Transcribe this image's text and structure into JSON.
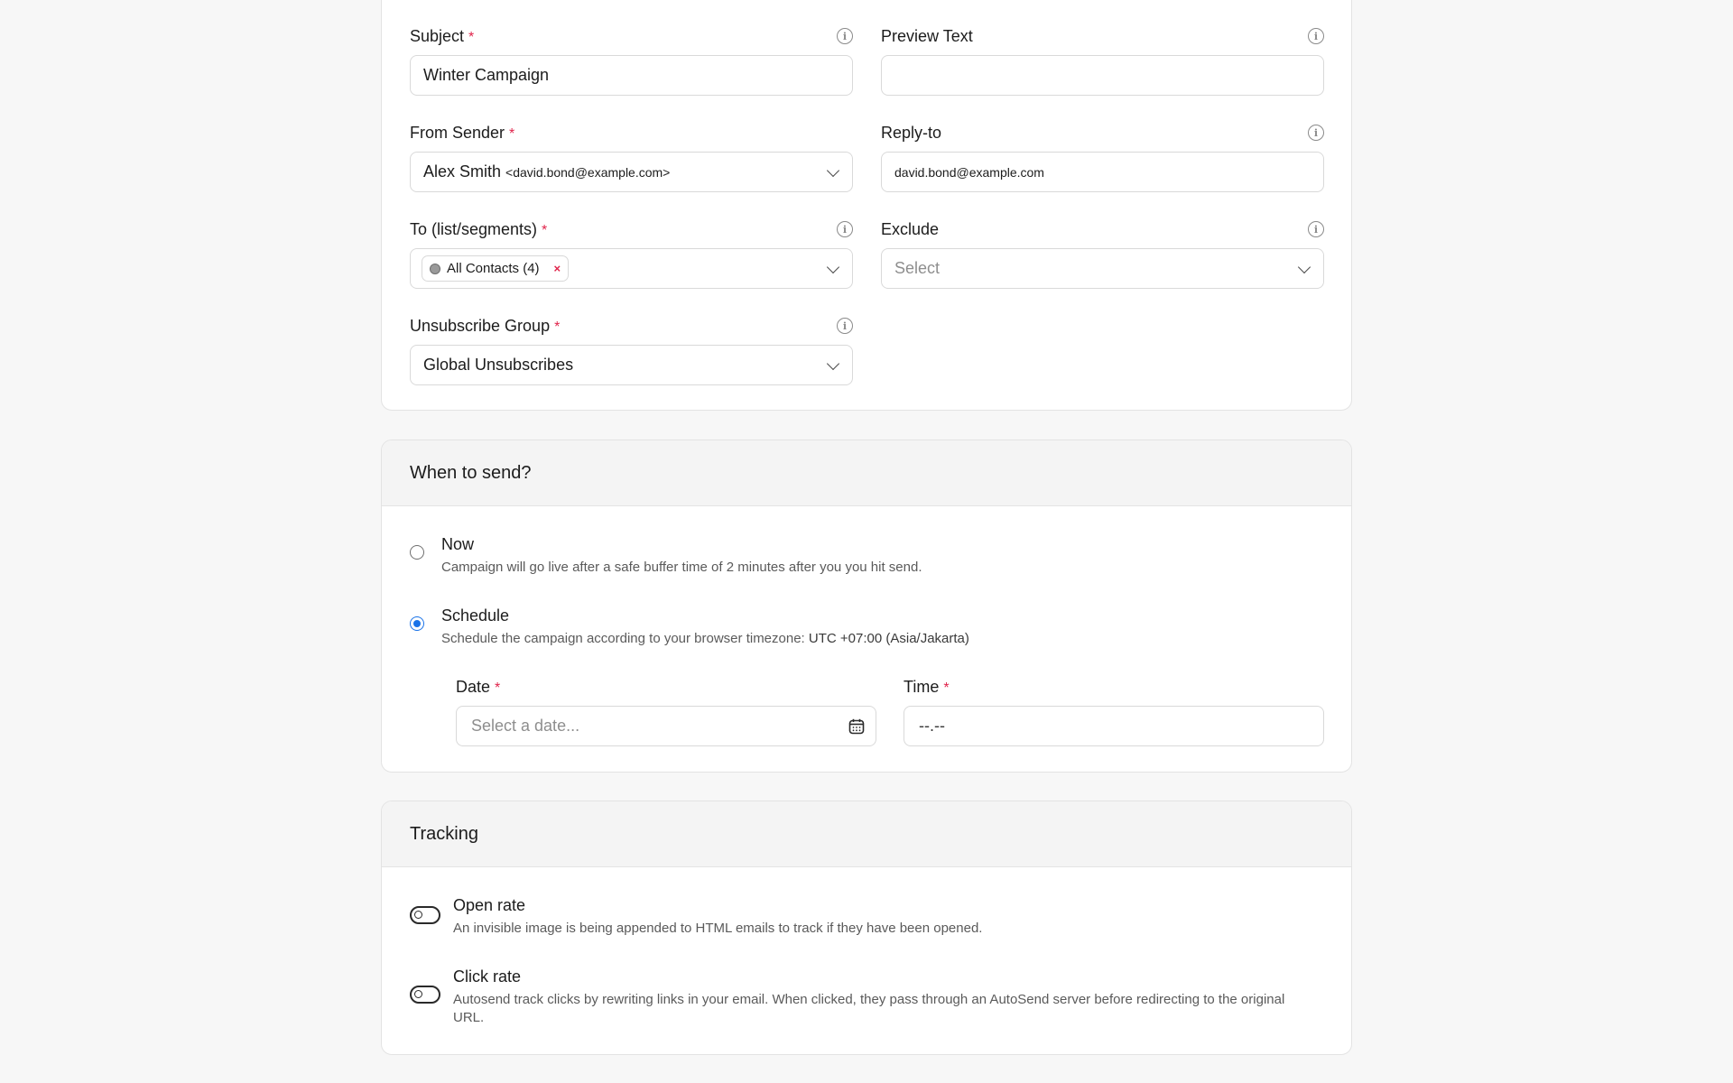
{
  "details": {
    "subject": {
      "label": "Subject",
      "required": "*",
      "value": "Winter Campaign"
    },
    "preview_text": {
      "label": "Preview Text",
      "value": ""
    },
    "from_sender": {
      "label": "From Sender",
      "required": "*",
      "name": "Alex Smith",
      "email": "<david.bond@example.com>"
    },
    "reply_to": {
      "label": "Reply-to",
      "value": "david.bond@example.com"
    },
    "to": {
      "label": "To (list/segments)",
      "required": "*",
      "tag": "All Contacts (4)",
      "tag_remove": "×"
    },
    "exclude": {
      "label": "Exclude",
      "placeholder": "Select"
    },
    "unsubscribe_group": {
      "label": "Unsubscribe Group",
      "required": "*",
      "value": "Global Unsubscribes"
    }
  },
  "when": {
    "title": "When to send?",
    "now": {
      "label": "Now",
      "description": "Campaign will go live after a safe buffer time of 2 minutes after you you hit send.",
      "selected": false
    },
    "schedule": {
      "label": "Schedule",
      "description": "Schedule the campaign according to your browser timezone:",
      "timezone": "UTC +07:00 (Asia/Jakarta)",
      "selected": true
    },
    "date": {
      "label": "Date",
      "required": "*",
      "placeholder": "Select a date..."
    },
    "time": {
      "label": "Time",
      "required": "*",
      "placeholder": "--.--"
    }
  },
  "tracking": {
    "title": "Tracking",
    "open_rate": {
      "label": "Open rate",
      "description": "An invisible image is being appended to HTML emails to track if they have been opened.",
      "enabled": false
    },
    "click_rate": {
      "label": "Click rate",
      "description": "Autosend track clicks by rewriting links in your email. When clicked, they pass through an AutoSend server before redirecting to the original URL.",
      "enabled": false
    }
  },
  "icons": {
    "info": "info-icon",
    "chevron": "chevron-down-icon",
    "calendar": "calendar-icon",
    "tag_dot": "list-dot-icon",
    "toggle": "toggle-icon"
  },
  "colors": {
    "required": "#e0244b",
    "radio_selected": "#1a73e8",
    "card_header_bg": "#f4f4f4",
    "page_bg": "#f7f7f7"
  }
}
